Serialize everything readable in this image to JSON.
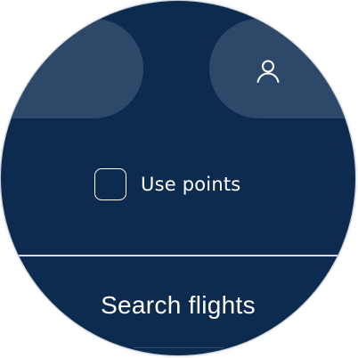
{
  "header": {
    "left_pill_label": "",
    "profile_icon": "person-outline-icon"
  },
  "options": {
    "use_points_label": "Use points",
    "use_points_checked": false
  },
  "actions": {
    "search_label": "Search flights"
  },
  "theme": {
    "background": "#0c2b4e",
    "pill": "#2e4869",
    "text": "#ffffff",
    "divider": "#d7dde5"
  }
}
